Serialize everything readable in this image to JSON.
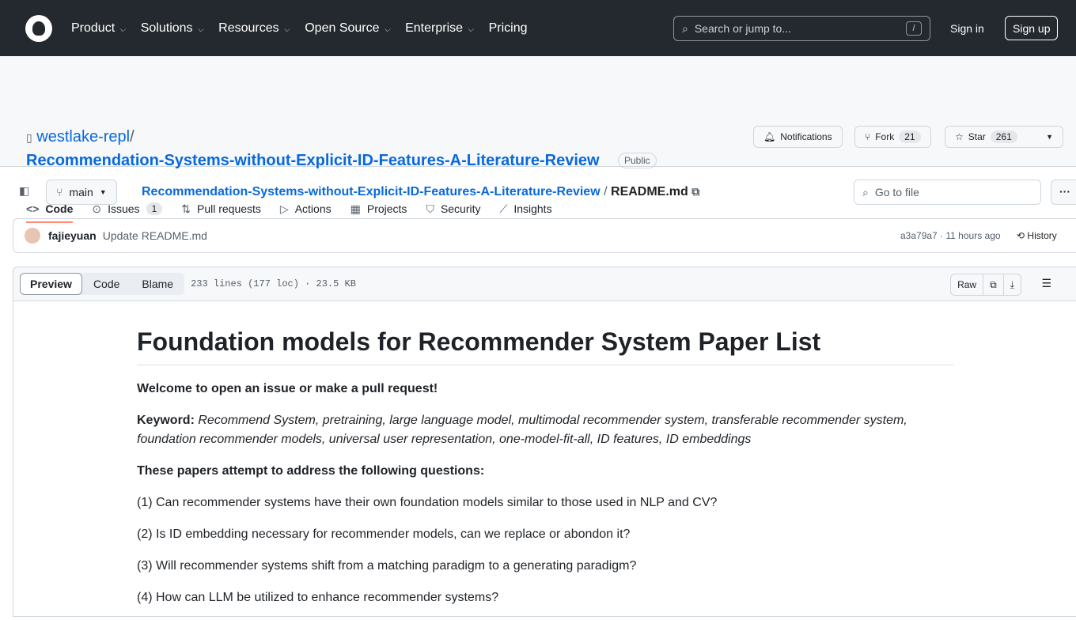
{
  "header": {
    "nav": [
      "Product",
      "Solutions",
      "Resources",
      "Open Source",
      "Enterprise",
      "Pricing"
    ],
    "search_placeholder": "Search or jump to...",
    "search_key": "/",
    "sign_in": "Sign in",
    "sign_up": "Sign up"
  },
  "repo": {
    "owner": "westlake-repl",
    "separator": "/",
    "name": "Recommendation-Systems-without-Explicit-ID-Features-A-Literature-Review",
    "visibility": "Public",
    "notifications": "Notifications",
    "fork": "Fork",
    "fork_count": "21",
    "star": "Star",
    "star_count": "261"
  },
  "tabs": [
    {
      "label": "Code",
      "icon": "code-icon"
    },
    {
      "label": "Issues",
      "count": "1",
      "icon": "issue-icon"
    },
    {
      "label": "Pull requests",
      "icon": "pull-request-icon"
    },
    {
      "label": "Actions",
      "icon": "play-icon"
    },
    {
      "label": "Projects",
      "icon": "table-icon"
    },
    {
      "label": "Security",
      "icon": "shield-icon"
    },
    {
      "label": "Insights",
      "icon": "graph-icon"
    }
  ],
  "file": {
    "branch": "main",
    "path_repo": "Recommendation-Systems-without-Explicit-ID-Features-A-Literature-Review",
    "path_sep": "/",
    "filename": "README.md",
    "goto_placeholder": "Go to file"
  },
  "commit": {
    "author": "fajieyuan",
    "message": "Update README.md",
    "sha_time": "a3a79a7 · 11 hours ago",
    "history": "History"
  },
  "viewer": {
    "preview": "Preview",
    "code": "Code",
    "blame": "Blame",
    "meta": "233 lines (177 loc) · 23.5 KB",
    "raw": "Raw"
  },
  "readme": {
    "title": "Foundation models for Recommender System Paper List",
    "welcome": "Welcome to open an issue or make a pull request!",
    "keyword_label": "Keyword:",
    "keywords": "Recommend System, pretraining, large language model, multimodal recommender system, transferable recommender system, foundation recommender models, universal user representation, one-model-fit-all, ID features, ID embeddings",
    "questions_heading": "These papers attempt to address the following questions:",
    "questions": [
      "(1) Can recommender systems have their own foundation models similar to those used in NLP and CV?",
      "(2) Is ID embedding necessary for recommender models, can we replace or abondon it?",
      "(3) Will recommender systems shift from a matching paradigm to a generating paradigm?",
      "(4) How can LLM be utilized to enhance recommender systems?"
    ]
  }
}
